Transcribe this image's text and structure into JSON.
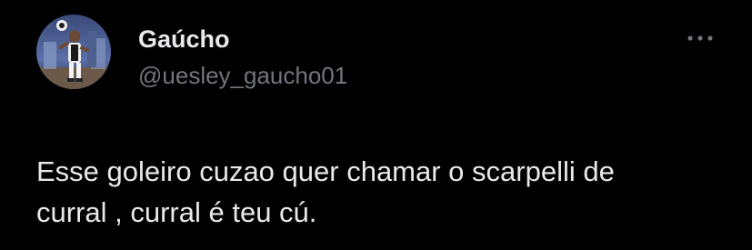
{
  "tweet": {
    "display_name": "Gaúcho",
    "handle": "@uesley_gaucho01",
    "text": "Esse goleiro cuzao quer chamar o scarpelli de\ncurral , curral é teu cú."
  },
  "icons": {
    "avatar": "profile-photo",
    "more": "more-horizontal-icon"
  },
  "colors": {
    "background": "#000000",
    "primary_text": "#e7e9ea",
    "secondary_text": "#71767b"
  }
}
